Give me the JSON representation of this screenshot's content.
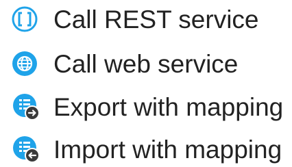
{
  "colors": {
    "icon_blue": "#1fa3e9",
    "badge_dark": "#3a3a3a",
    "text": "#222222"
  },
  "menu": {
    "items": [
      {
        "label": "Call REST service",
        "icon": "rest-brackets-icon"
      },
      {
        "label": "Call web service",
        "icon": "globe-icon"
      },
      {
        "label": "Export with mapping",
        "icon": "export-mapping-icon"
      },
      {
        "label": "Import with mapping",
        "icon": "import-mapping-icon"
      }
    ]
  }
}
